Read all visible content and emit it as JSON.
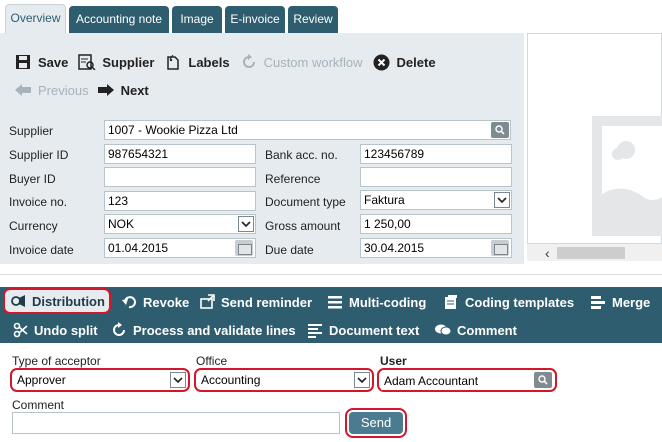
{
  "tabs": [
    {
      "label": "Overview",
      "active": true
    },
    {
      "label": "Accounting note"
    },
    {
      "label": "Image"
    },
    {
      "label": "E-invoice"
    },
    {
      "label": "Review"
    }
  ],
  "toolbar": {
    "save": "Save",
    "supplier": "Supplier",
    "labels": "Labels",
    "custom_workflow": "Custom workflow",
    "delete": "Delete",
    "previous": "Previous",
    "next": "Next"
  },
  "form": {
    "supplier_label": "Supplier",
    "supplier_value": "1007 - Wookie Pizza Ltd",
    "supplier_id_label": "Supplier ID",
    "supplier_id_value": "987654321",
    "bank_acc_label": "Bank acc. no.",
    "bank_acc_value": "123456789",
    "buyer_id_label": "Buyer ID",
    "buyer_id_value": "",
    "reference_label": "Reference",
    "reference_value": "",
    "invoice_no_label": "Invoice no.",
    "invoice_no_value": "123",
    "document_type_label": "Document type",
    "document_type_value": "Faktura",
    "currency_label": "Currency",
    "currency_value": "NOK",
    "gross_amount_label": "Gross amount",
    "gross_amount_value": "1 250,00",
    "invoice_date_label": "Invoice date",
    "invoice_date_value": "01.04.2015",
    "due_date_label": "Due date",
    "due_date_value": "30.04.2015"
  },
  "distribution_toolbar": {
    "distribution": "Distribution",
    "revoke": "Revoke",
    "send_reminder": "Send reminder",
    "multi_coding": "Multi-coding",
    "coding_templates": "Coding templates",
    "merge": "Merge",
    "undo_split": "Undo split",
    "process_validate": "Process and validate lines",
    "document_text": "Document text",
    "comment": "Comment"
  },
  "distribution_form": {
    "type_of_acceptor_label": "Type of acceptor",
    "type_of_acceptor_value": "Approver",
    "office_label": "Office",
    "office_value": "Accounting",
    "user_label": "User",
    "user_value": "Adam Accountant",
    "comment_label": "Comment",
    "comment_value": "",
    "send_label": "Send"
  },
  "colors": {
    "accent": "#2e5d70",
    "panel": "#e6ebef",
    "highlight": "#d3162a"
  }
}
